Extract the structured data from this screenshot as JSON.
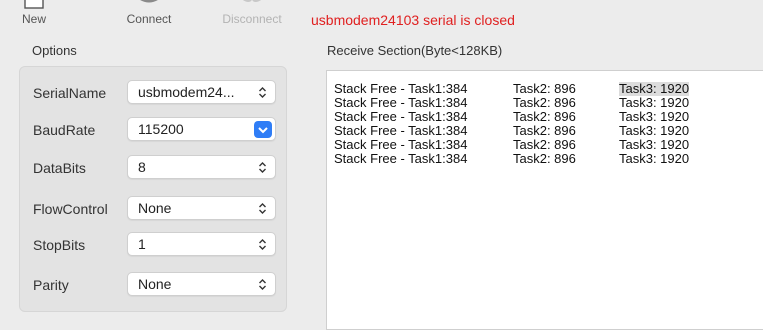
{
  "toolbar": {
    "new_label": "New",
    "connect_label": "Connect",
    "disconnect_label": "Disconnect"
  },
  "status": {
    "text": "usbmodem24103 serial is closed",
    "color": "#e02020"
  },
  "options": {
    "title": "Options",
    "rows": [
      {
        "label": "SerialName",
        "value": "usbmodem24..."
      },
      {
        "label": "BaudRate",
        "value": "115200"
      },
      {
        "label": "DataBits",
        "value": "8"
      },
      {
        "label": "FlowControl",
        "value": "None"
      },
      {
        "label": "StopBits",
        "value": "1"
      },
      {
        "label": "Parity",
        "value": "None"
      }
    ]
  },
  "receive": {
    "title": "Receive Section(Byte<128KB)",
    "lines": [
      {
        "c1": "Stack Free - Task1:384",
        "c2": "Task2: 896",
        "c3": "Task3: 1920"
      },
      {
        "c1": "Stack Free - Task1:384",
        "c2": "Task2: 896",
        "c3": "Task3: 1920"
      },
      {
        "c1": "Stack Free - Task1:384",
        "c2": "Task2: 896",
        "c3": "Task3: 1920"
      },
      {
        "c1": "Stack Free - Task1:384",
        "c2": "Task2: 896",
        "c3": "Task3: 1920"
      },
      {
        "c1": "Stack Free - Task1:384",
        "c2": "Task2: 896",
        "c3": "Task3: 1920"
      },
      {
        "c1": "Stack Free - Task1:384",
        "c2": "Task2: 896",
        "c3": "Task3: 1920"
      }
    ]
  },
  "icons": {
    "new": "new-document-icon",
    "connect": "connect-icon",
    "disconnect": "disconnect-icon",
    "updown": "chevron-updown-icon"
  },
  "colors": {
    "accent": "#2f7df6",
    "error": "#e02020"
  }
}
